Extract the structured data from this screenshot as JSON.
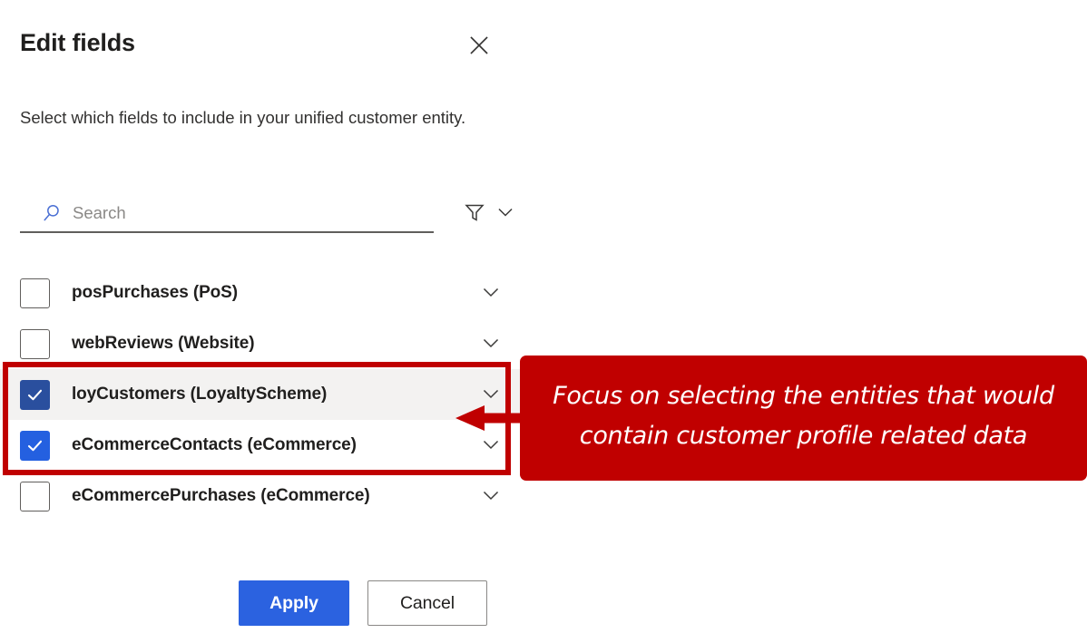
{
  "panel": {
    "title": "Edit fields",
    "description": "Select which fields to include in your unified customer entity.",
    "close_icon": "close-icon"
  },
  "search": {
    "placeholder": "Search",
    "value": "",
    "search_icon": "search-icon",
    "filter_icon": "filter-icon",
    "filter_chevron_icon": "chevron-down-icon"
  },
  "entities": [
    {
      "label": "posPurchases (PoS)",
      "checked": false,
      "hover": false,
      "pressed": false,
      "expand_icon": "chevron-down-icon"
    },
    {
      "label": "webReviews (Website)",
      "checked": false,
      "hover": false,
      "pressed": false,
      "expand_icon": "chevron-down-icon"
    },
    {
      "label": "loyCustomers (LoyaltyScheme)",
      "checked": true,
      "hover": true,
      "pressed": true,
      "expand_icon": "chevron-down-icon"
    },
    {
      "label": "eCommerceContacts (eCommerce)",
      "checked": true,
      "hover": false,
      "pressed": false,
      "expand_icon": "chevron-down-icon"
    },
    {
      "label": "eCommercePurchases (eCommerce)",
      "checked": false,
      "hover": false,
      "pressed": false,
      "expand_icon": "chevron-down-icon"
    }
  ],
  "footer": {
    "apply_label": "Apply",
    "cancel_label": "Cancel"
  },
  "annotation": {
    "text": "Focus on selecting the entities that would contain customer profile related data",
    "color": "#c00000"
  },
  "colors": {
    "accent_blue": "#2b62e0",
    "checkbox_pressed_blue": "#2a4f9e",
    "hover_row": "#f3f2f1",
    "text_primary": "#201f1e",
    "text_secondary": "#323130",
    "border_gray": "#605e5c",
    "annotation_red": "#c00000"
  }
}
